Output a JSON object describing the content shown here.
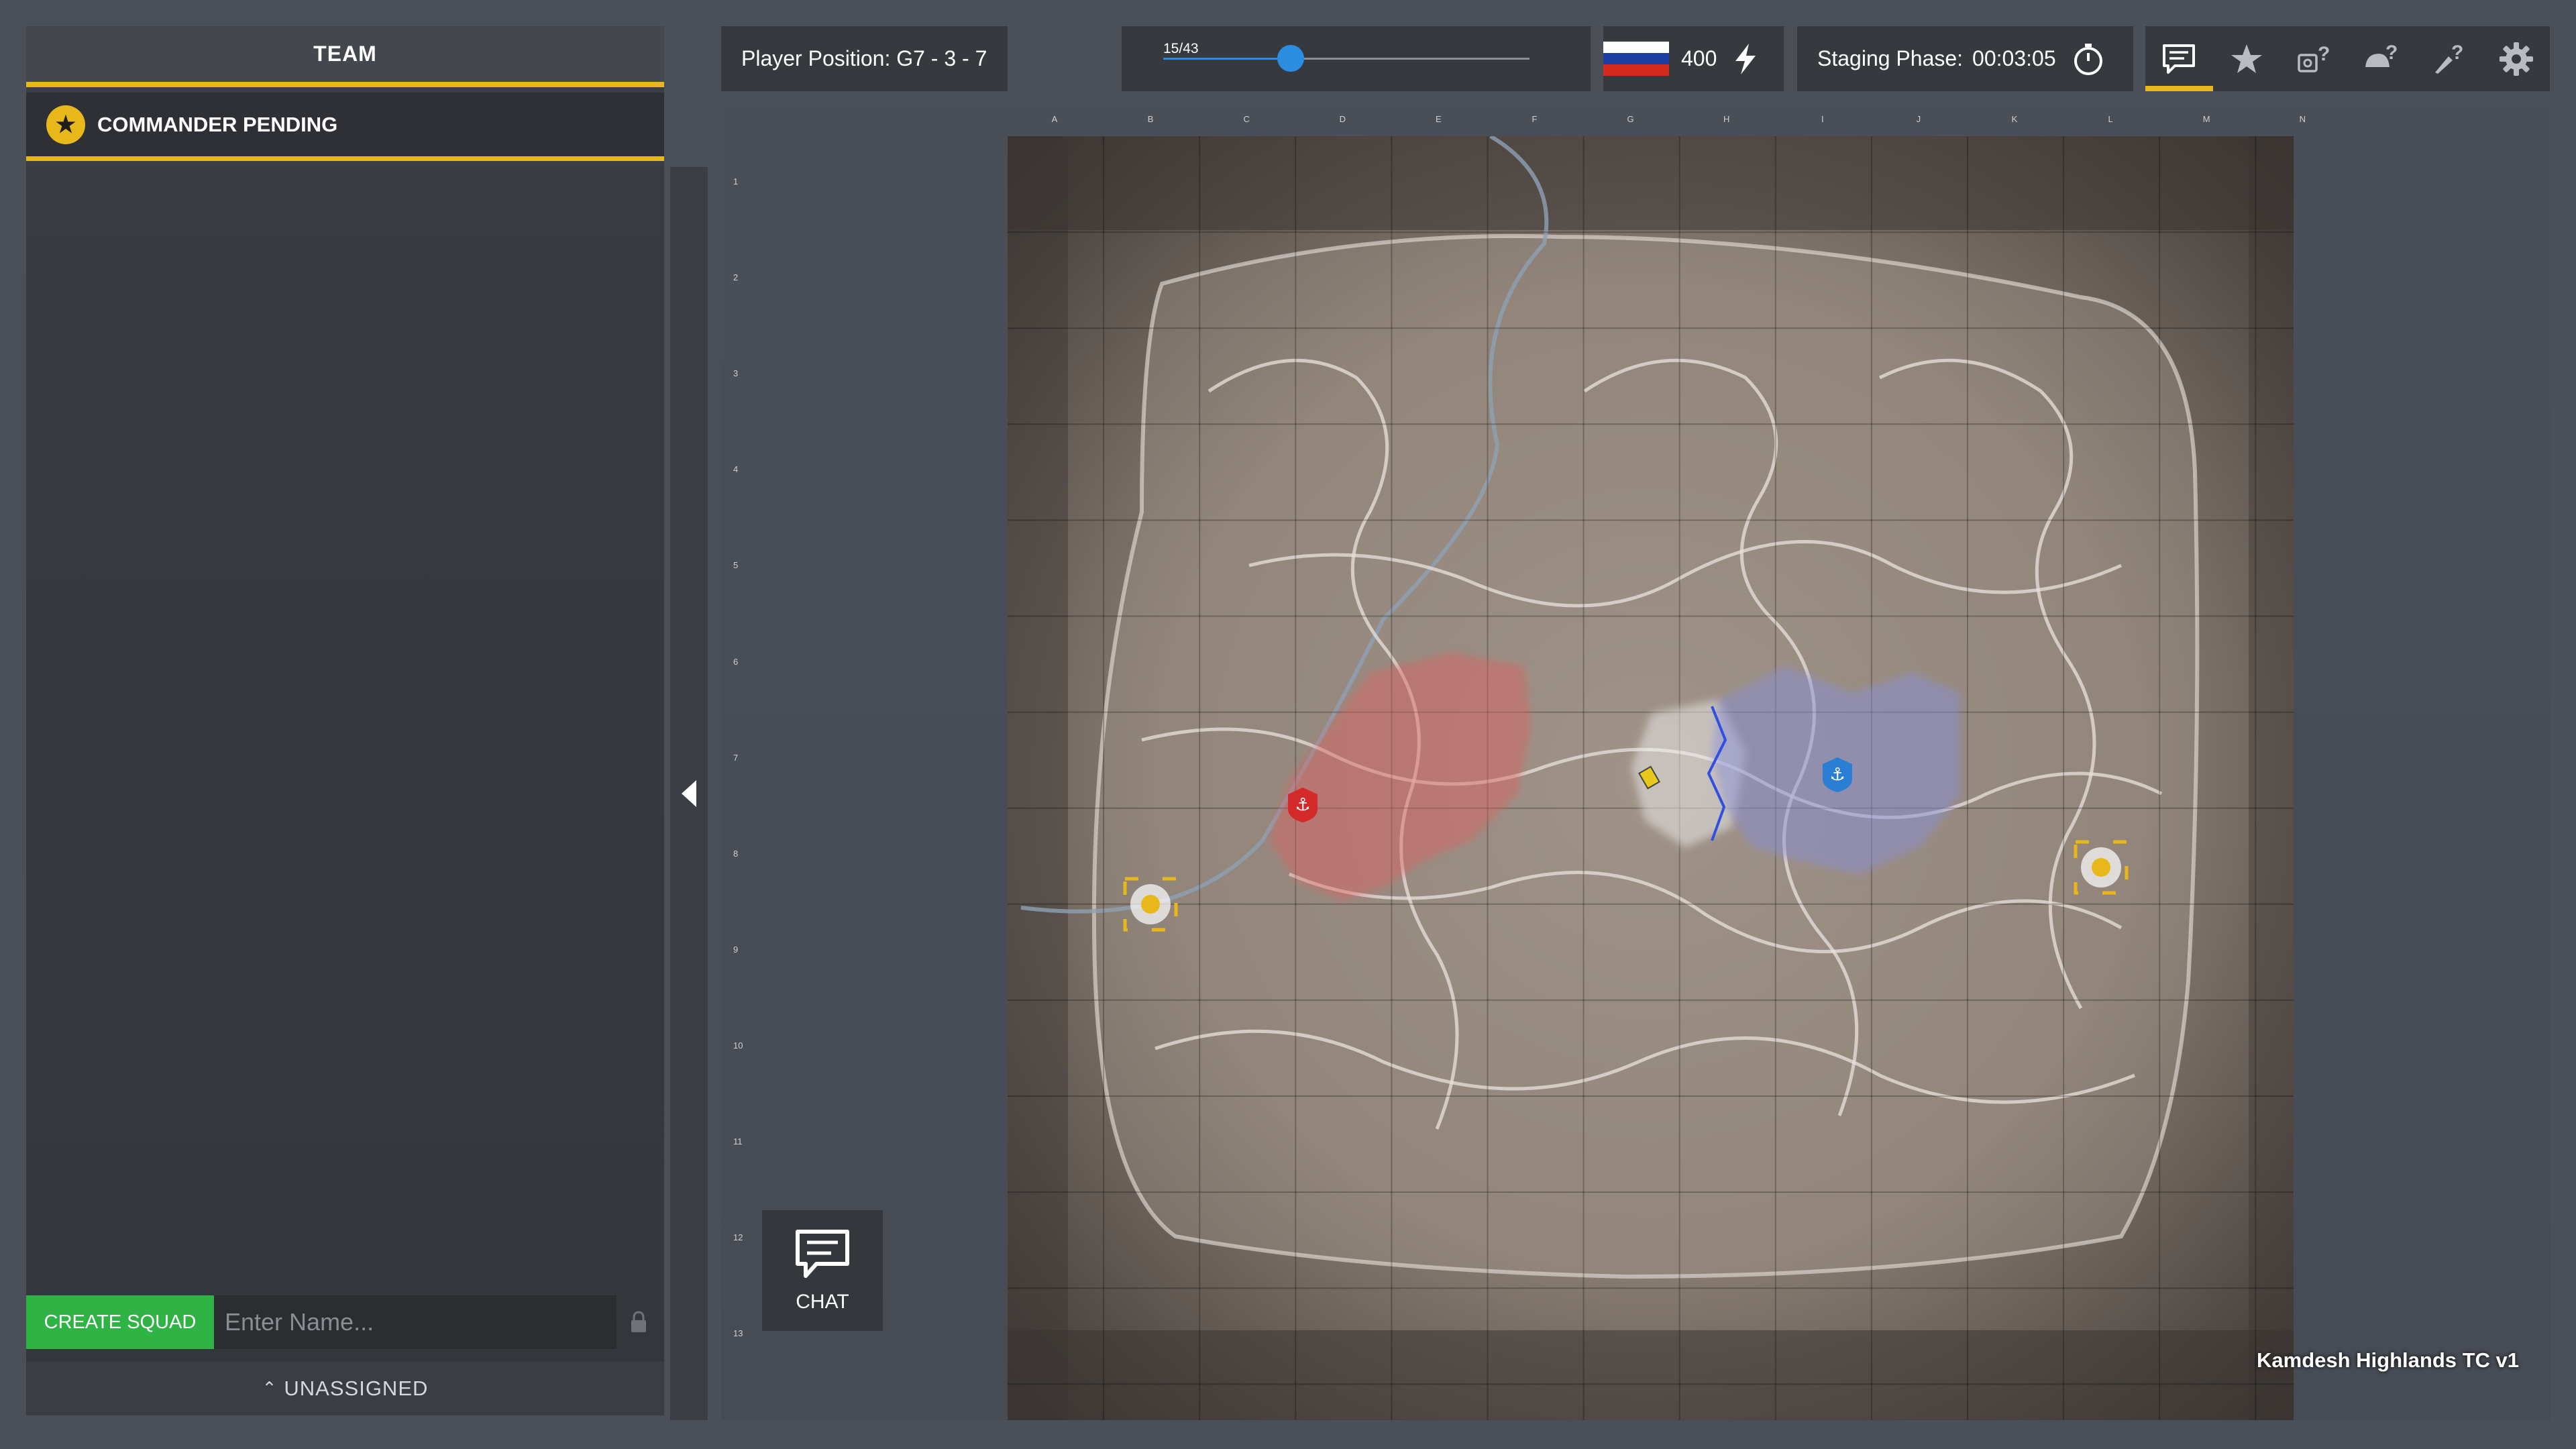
{
  "team_panel": {
    "title": "TEAM",
    "commander_label": "COMMANDER PENDING",
    "create_squad_label": "CREATE SQUAD",
    "squad_name_placeholder": "Enter Name...",
    "unassigned_label": "UNASSIGNED"
  },
  "top_bar": {
    "player_position": "Player Position: G7 - 3 - 7",
    "tickets": {
      "label": "15/43",
      "current": 15,
      "total": 43
    },
    "faction": {
      "name": "Russia",
      "points": "400",
      "flag_colors": [
        "#ffffff",
        "#1c3fa6",
        "#d52b1e"
      ]
    },
    "phase": {
      "label": "Staging Phase:",
      "timer": "00:03:05"
    },
    "toolbar": [
      {
        "id": "chat",
        "icon": "chat-icon",
        "active": true
      },
      {
        "id": "favorites",
        "icon": "star-icon",
        "active": false
      },
      {
        "id": "vehicle-help",
        "icon": "vehicle-question-icon",
        "active": false
      },
      {
        "id": "kit-help",
        "icon": "helmet-question-icon",
        "active": false
      },
      {
        "id": "deploy-help",
        "icon": "rocket-question-icon",
        "active": false
      },
      {
        "id": "settings",
        "icon": "gear-icon",
        "active": false
      }
    ]
  },
  "map": {
    "name": "Kamdesh Highlands TC v1",
    "columns": [
      "A",
      "B",
      "C",
      "D",
      "E",
      "F",
      "G",
      "H",
      "I",
      "J",
      "K",
      "L",
      "M",
      "N"
    ],
    "rows": [
      "1",
      "2",
      "3",
      "4",
      "5",
      "6",
      "7",
      "8",
      "9",
      "10",
      "11",
      "12",
      "13"
    ],
    "markers": {
      "red_hab": "red-anchor-icon",
      "blue_hab": "blue-anchor-icon",
      "player": "player-position-icon",
      "main_base_west": "main-base-icon",
      "main_base_east": "main-base-icon"
    },
    "colors": {
      "red_zone": "#e06060",
      "blue_zone": "#8a8fd8"
    }
  },
  "chat_button": {
    "label": "CHAT"
  }
}
